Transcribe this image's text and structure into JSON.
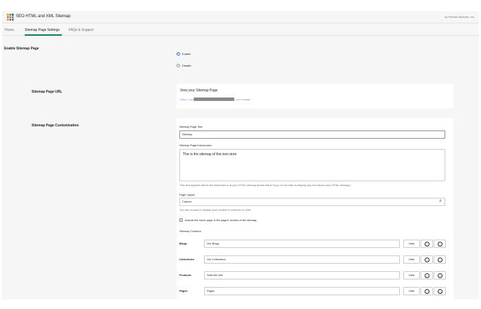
{
  "app": {
    "title": "SEO HTML and XML Sitemap",
    "byline": "by Pereira Ventures, Inc."
  },
  "tabs": [
    {
      "label": "Home"
    },
    {
      "label": "Sitemap Page Settings",
      "active": true
    },
    {
      "label": "FAQs & Support"
    }
  ],
  "enable_section": {
    "title": "Enable Sitemap Page",
    "options": [
      {
        "label": "Enable",
        "checked": true
      },
      {
        "label": "Disable",
        "checked": false
      }
    ]
  },
  "url_section": {
    "title": "Sitemap Page URL",
    "card_title": "View your Sitemap Page",
    "url_prefix": "https://www.",
    "url_suffix": "/a/s/sitemap"
  },
  "customization": {
    "title": "Sitemap Page Customization",
    "page_title_label": "Sitemap Page Title",
    "page_title_value": "Sitemap",
    "intro_label": "Sitemap Page Introduction",
    "intro_value": "This is the sitemap of this test store",
    "intro_help": "This text appears above the links/menus of your HTML sitemap (leave blank if you do not wish to display any text above your HTML sitemap)",
    "layout_label": "Page Layout",
    "layout_value": "Column",
    "layout_help": "You can choose to display your content in columns or rows.",
    "include_home_label": "Include the home page in the pages' section of the sitemap.",
    "include_home_checked": true,
    "columns_label": "Sitemap Columns",
    "hide_label": "Hide",
    "columns": [
      {
        "name": "Blogs",
        "value": "Our Blogs"
      },
      {
        "name": "Collections",
        "value": "Our Collections"
      },
      {
        "name": "Products",
        "value": "Stuff We Sell"
      },
      {
        "name": "Pages",
        "value": "Pages"
      }
    ]
  },
  "colors": {
    "accent": "#008060",
    "link": "#2c6ecb",
    "background": "#f6f6f7",
    "logo": [
      "#e8a13a",
      "#3b8f5a",
      "#2c6ecb",
      "#d9534f",
      "#6d4bb5",
      "#3b8f5a",
      "#e8a13a",
      "#2c6ecb",
      "#d9534f"
    ]
  }
}
